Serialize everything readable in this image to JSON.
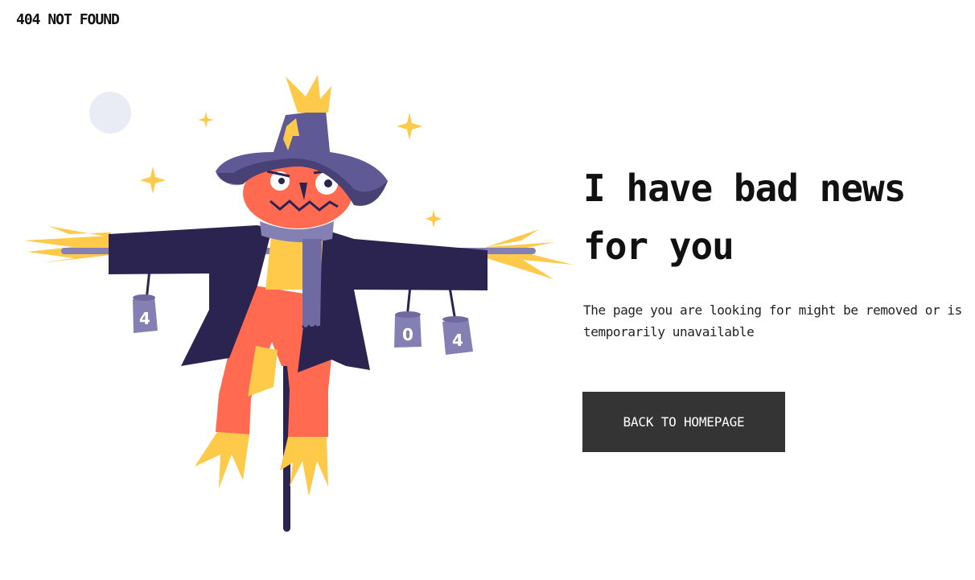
{
  "header": {
    "brand": "404 NOT FOUND"
  },
  "illustration": {
    "subject": "scarecrow",
    "cans": [
      "4",
      "0",
      "4"
    ]
  },
  "main": {
    "headline": "I have bad news for you",
    "message": "The page you are looking for might be removed or is temporarily unavailable",
    "button_label": "BACK TO HOMEPAGE"
  },
  "colors": {
    "button_bg": "#343434",
    "button_text": "#ffffff",
    "coat": "#2b2450",
    "hat": "#5f5996",
    "head": "#ff6a50",
    "straw": "#ffc94a",
    "scarf": "#6f6aa2",
    "can": "#8580b3",
    "moon": "#e9ebf5"
  }
}
